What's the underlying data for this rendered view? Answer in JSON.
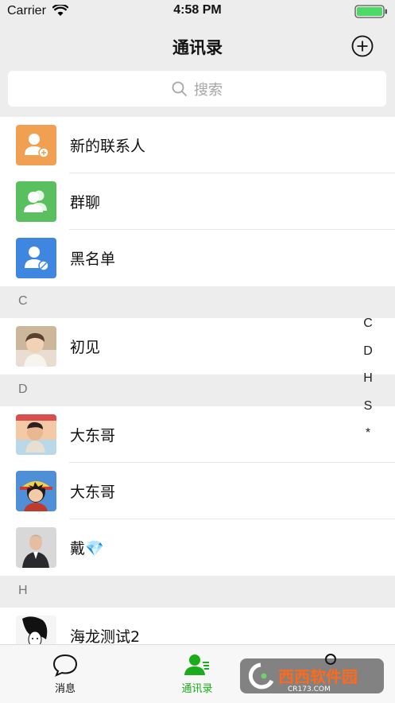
{
  "status": {
    "carrier": "Carrier",
    "time": "4:58 PM"
  },
  "nav": {
    "title": "通讯录"
  },
  "search": {
    "placeholder": "搜索"
  },
  "top_items": [
    {
      "label": "新的联系人",
      "icon": "new-contact-icon",
      "color": "#f0a050"
    },
    {
      "label": "群聊",
      "icon": "group-chat-icon",
      "color": "#5ac05f"
    },
    {
      "label": "黑名单",
      "icon": "blacklist-icon",
      "color": "#3f86e0"
    }
  ],
  "sections": [
    {
      "letter": "C",
      "contacts": [
        {
          "name": "初见"
        }
      ]
    },
    {
      "letter": "D",
      "contacts": [
        {
          "name": "大东哥"
        },
        {
          "name": "大东哥"
        },
        {
          "name": "戴💎"
        }
      ]
    },
    {
      "letter": "H",
      "contacts": [
        {
          "name": "海龙测试2"
        }
      ]
    }
  ],
  "index_letters": [
    "C",
    "D",
    "H",
    "S",
    "*"
  ],
  "tabs": [
    {
      "label": "消息",
      "icon": "chat-bubble-icon",
      "active": false
    },
    {
      "label": "通讯录",
      "icon": "contacts-icon",
      "active": true
    }
  ],
  "colors": {
    "active_tab": "#1aad19",
    "background": "#ededed"
  },
  "watermark": {
    "text": "西西软件园",
    "subtext": "CR173.COM"
  }
}
